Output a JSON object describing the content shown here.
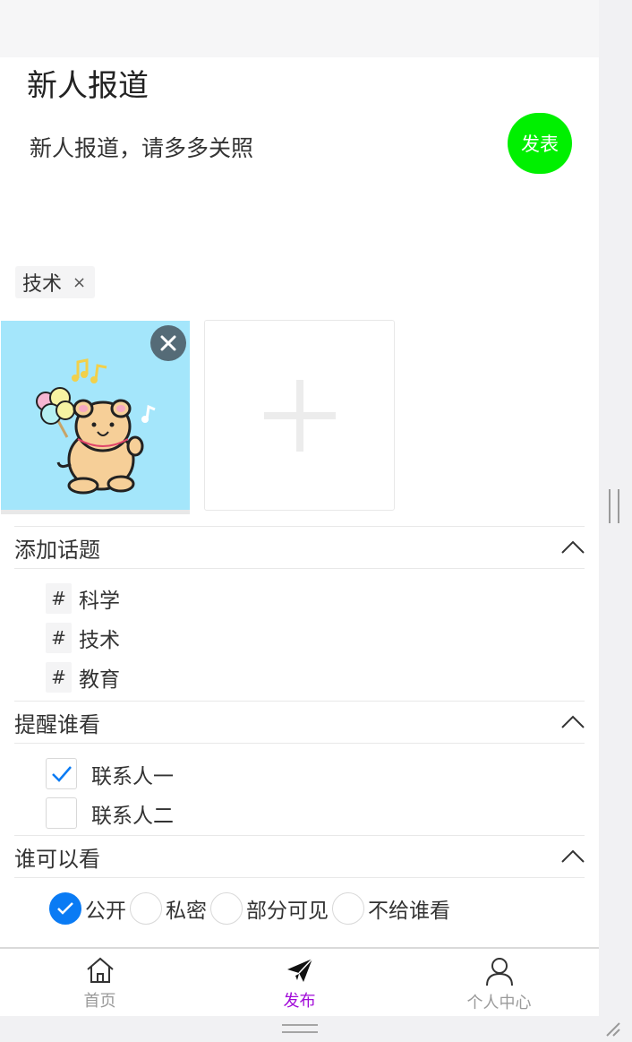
{
  "post": {
    "title": "新人报道",
    "content": "新人报道，请多多关照",
    "publish_label": "发表",
    "tag_label": "技术",
    "tag_remove": "×"
  },
  "topics": {
    "header": "添加话题",
    "hash": "#",
    "items": [
      "科学",
      "技术",
      "教育"
    ]
  },
  "remind": {
    "header": "提醒谁看",
    "items": [
      {
        "label": "联系人一",
        "checked": true
      },
      {
        "label": "联系人二",
        "checked": false
      }
    ]
  },
  "visibility": {
    "header": "谁可以看",
    "options": [
      "公开",
      "私密",
      "部分可见",
      "不给谁看"
    ],
    "selected": "公开"
  },
  "tabbar": {
    "items": [
      {
        "label": "首页",
        "icon": "home-icon"
      },
      {
        "label": "发布",
        "icon": "paper-plane-icon"
      },
      {
        "label": "个人中心",
        "icon": "user-icon"
      }
    ],
    "active": "发布"
  },
  "colors": {
    "publish": "#00f000",
    "accent": "#0a7bf4",
    "active_tab": "#a10bd8"
  }
}
